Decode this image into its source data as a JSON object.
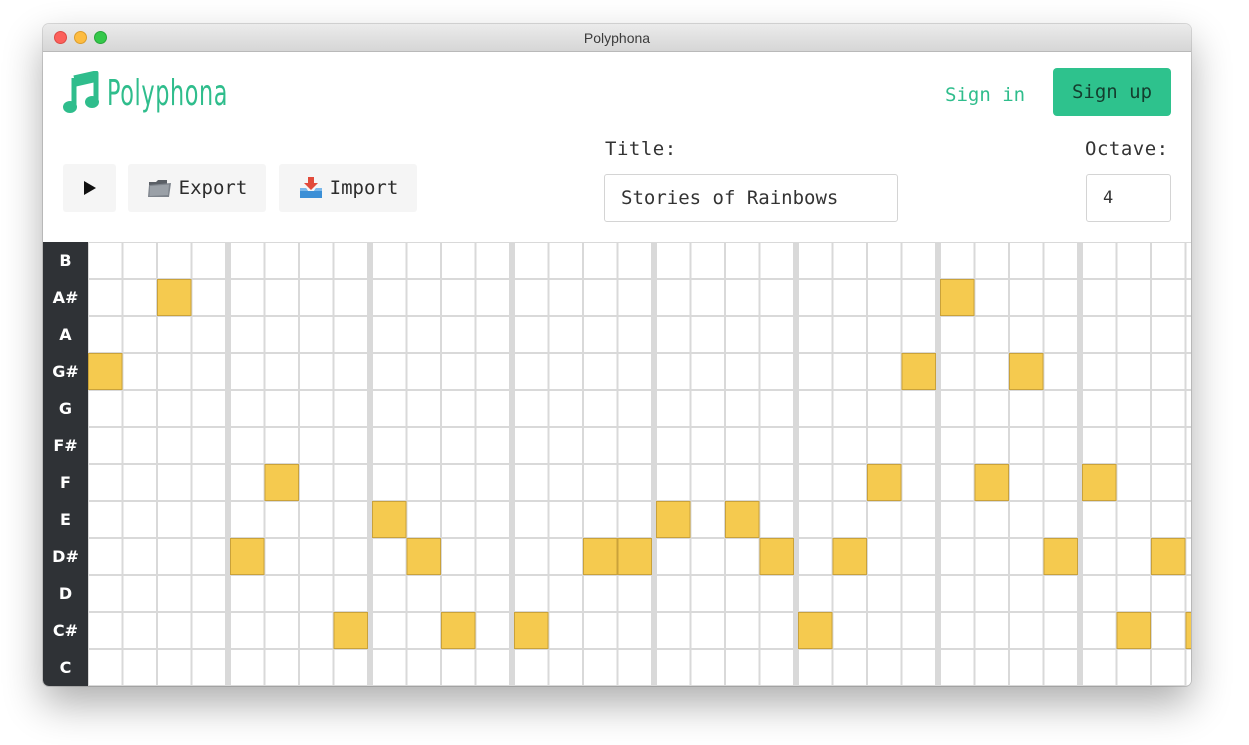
{
  "window": {
    "title": "Polyphona"
  },
  "header": {
    "logo_text": "Polyphona",
    "logo_icon": "music-note-icon",
    "sign_in": "Sign in",
    "sign_up": "Sign up"
  },
  "toolbar": {
    "play_icon": "play-icon",
    "export_label": "Export",
    "export_icon": "folder-icon",
    "import_label": "Import",
    "import_icon": "inbox-tray-icon"
  },
  "form": {
    "title_label": "Title:",
    "title_value": "Stories of Rainbows",
    "octave_label": "Octave:",
    "octave_value": "4"
  },
  "colors": {
    "accent": "#2fbd8c",
    "note_fill": "#f5ca4f",
    "note_border": "#caa23a",
    "key_column": "#2f3236"
  },
  "sequencer": {
    "notes": [
      "B",
      "A#",
      "A",
      "G#",
      "G",
      "F#",
      "F",
      "E",
      "D#",
      "D",
      "C#",
      "C"
    ],
    "steps_per_bar": 4,
    "bars": 8,
    "active_cells": [
      {
        "step": 0,
        "note": "G#"
      },
      {
        "step": 2,
        "note": "A#"
      },
      {
        "step": 4,
        "note": "D#"
      },
      {
        "step": 5,
        "note": "F"
      },
      {
        "step": 7,
        "note": "C#"
      },
      {
        "step": 8,
        "note": "E"
      },
      {
        "step": 9,
        "note": "D#"
      },
      {
        "step": 10,
        "note": "C#"
      },
      {
        "step": 12,
        "note": "C#"
      },
      {
        "step": 14,
        "note": "D#"
      },
      {
        "step": 15,
        "note": "D#"
      },
      {
        "step": 16,
        "note": "E"
      },
      {
        "step": 18,
        "note": "E"
      },
      {
        "step": 19,
        "note": "D#"
      },
      {
        "step": 20,
        "note": "C#"
      },
      {
        "step": 21,
        "note": "D#"
      },
      {
        "step": 22,
        "note": "F"
      },
      {
        "step": 23,
        "note": "G#"
      },
      {
        "step": 24,
        "note": "A#"
      },
      {
        "step": 25,
        "note": "F"
      },
      {
        "step": 26,
        "note": "G#"
      },
      {
        "step": 27,
        "note": "D#"
      },
      {
        "step": 28,
        "note": "F"
      },
      {
        "step": 29,
        "note": "C#"
      },
      {
        "step": 30,
        "note": "D#"
      },
      {
        "step": 31,
        "note": "C#"
      }
    ]
  }
}
